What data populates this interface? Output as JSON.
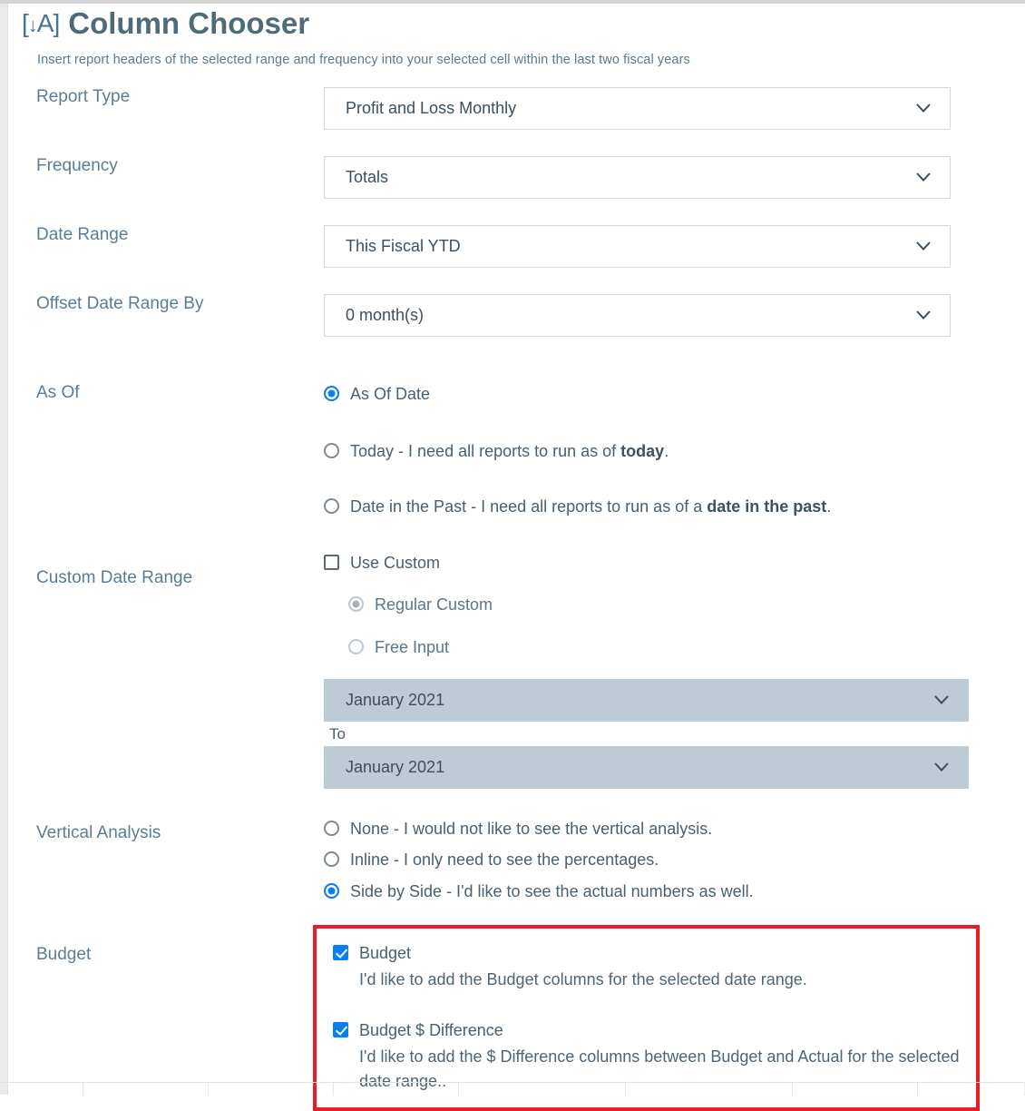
{
  "header": {
    "icon": "[↓A]",
    "icon_bracket_open": "[",
    "icon_arrow": "↓",
    "icon_letter": "A",
    "icon_bracket_close": "]",
    "title": "Column Chooser",
    "subtitle": "Insert report headers of the selected range and frequency into your selected cell within the last two fiscal years"
  },
  "fields": {
    "report_type": {
      "label": "Report Type",
      "value": "Profit and Loss Monthly"
    },
    "frequency": {
      "label": "Frequency",
      "value": "Totals"
    },
    "date_range": {
      "label": "Date Range",
      "value": "This Fiscal YTD"
    },
    "offset_date_range": {
      "label": "Offset Date Range By",
      "value": "0 month(s)"
    }
  },
  "as_of": {
    "label": "As Of",
    "options": [
      {
        "text": "As Of Date",
        "selected": true
      },
      {
        "text_before": "Today - I need all reports to run as of ",
        "bold": "today",
        "text_after": ".",
        "selected": false
      },
      {
        "text_before": "Date in the Past - I need all reports to run as of a ",
        "bold": "date in the past",
        "text_after": ".",
        "selected": false
      }
    ]
  },
  "custom_date_range": {
    "label": "Custom Date Range",
    "use_custom": {
      "text": "Use Custom",
      "checked": false
    },
    "mode_options": [
      {
        "text": "Regular Custom",
        "selected": true,
        "disabled": true
      },
      {
        "text": "Free Input",
        "selected": false,
        "disabled": true
      }
    ],
    "from_value": "January 2021",
    "to_label": "To",
    "to_value": "January 2021"
  },
  "vertical_analysis": {
    "label": "Vertical Analysis",
    "options": [
      {
        "text": "None - I would not like to see the vertical analysis.",
        "selected": false
      },
      {
        "text": "Inline - I only need to see the percentages.",
        "selected": false
      },
      {
        "text": "Side by Side - I'd like to see the actual numbers as well.",
        "selected": true
      }
    ]
  },
  "budget": {
    "label": "Budget",
    "highlight_color": "#ed1c24",
    "items": [
      {
        "title": "Budget",
        "checked": true,
        "description": "I'd like to add the Budget columns for the selected date range."
      },
      {
        "title": "Budget $ Difference",
        "checked": true,
        "description": "I'd like to add the $ Difference columns between Budget and Actual for the selected date range.."
      }
    ]
  },
  "colors": {
    "accent_blue": "#0a7ff2",
    "label_text": "#5b7d93",
    "title_text": "#4f6b7a",
    "disabled_field": "#bfcbd4",
    "highlight_red": "#ed1c24"
  }
}
